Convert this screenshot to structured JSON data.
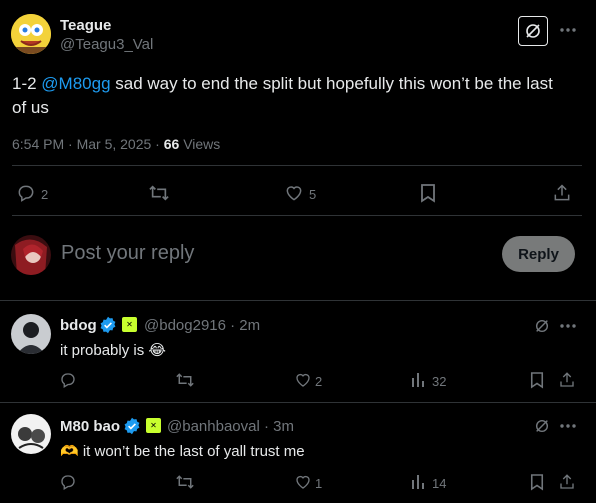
{
  "main_tweet": {
    "author_name": "Teague",
    "author_handle": "@Teagu3_Val",
    "text_prefix": "1-2 ",
    "mention": "@M80gg",
    "text_suffix": " sad way to end the split but hopefully this won’t be the last",
    "text_line2": "of us",
    "time": "6:54 PM · Mar 5, 2025 · ",
    "views_count": "66",
    "views_label": " Views",
    "reply_count": "2",
    "like_count": "5"
  },
  "composer": {
    "placeholder": "Post your reply",
    "reply_label": "Reply"
  },
  "replies": [
    {
      "name": "bdog",
      "handle": "@bdog2916 · 2m",
      "text": "it probably is 😂",
      "likes": "2",
      "views": "32"
    },
    {
      "name": "M80 bao",
      "handle": "@banhbaoval · 3m",
      "text": "🫶 it won’t be the last of yall trust me",
      "likes": "1",
      "views": "14"
    }
  ],
  "colors": {
    "accent": "#1d9bf0",
    "muted": "#71767b",
    "text": "#e7e9ea",
    "divider": "#2f3336"
  }
}
